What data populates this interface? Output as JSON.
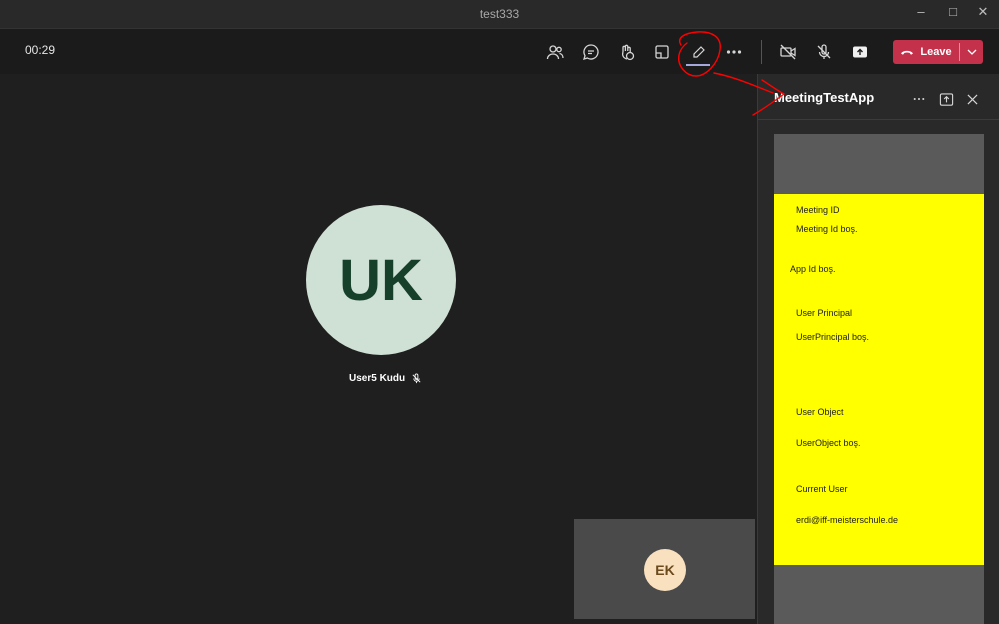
{
  "window": {
    "title": "test333"
  },
  "toolbar": {
    "timer": "00:29",
    "leave_label": "Leave",
    "icons": [
      "participants-icon",
      "chat-icon",
      "reactions-icon",
      "room-view-icon",
      "app-pencil-icon",
      "more-icon",
      "camera-off-icon",
      "mic-off-icon",
      "share-icon"
    ]
  },
  "stage": {
    "participant_initials": "UK",
    "participant_name": "User5 Kudu",
    "self_initials": "EK"
  },
  "panel": {
    "title": "MeetingTestApp",
    "lines": {
      "meeting_id_label": "Meeting ID",
      "meeting_id_value": "Meeting Id boş.",
      "app_id_value": "App Id boş.",
      "user_principal_label": "User Principal",
      "user_principal_value": "UserPrincipal boş.",
      "user_object_label": "User Object",
      "user_object_value": "UserObject boş.",
      "current_user_label": "Current User",
      "current_user_value": "erdi@iff-meisterschule.de"
    }
  },
  "colors": {
    "leave_button": "#c4314b",
    "app_background": "#ffff00",
    "avatar_uk": "#cfe0d5",
    "avatar_ek": "#f9e0bf",
    "annotation": "#ff0000"
  }
}
